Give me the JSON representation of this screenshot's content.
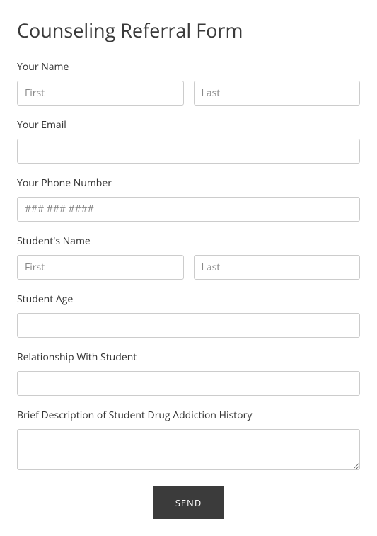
{
  "title": "Counseling Referral Form",
  "fields": {
    "yourName": {
      "label": "Your Name",
      "firstPlaceholder": "First",
      "lastPlaceholder": "Last"
    },
    "yourEmail": {
      "label": "Your Email"
    },
    "yourPhone": {
      "label": "Your Phone Number",
      "placeholder": "### ### ####"
    },
    "studentName": {
      "label": "Student's Name",
      "firstPlaceholder": "First",
      "lastPlaceholder": "Last"
    },
    "studentAge": {
      "label": "Student Age"
    },
    "relationship": {
      "label": "Relationship With Student"
    },
    "description": {
      "label": "Brief Description of Student Drug Addiction History"
    }
  },
  "submit": {
    "label": "SEND"
  }
}
